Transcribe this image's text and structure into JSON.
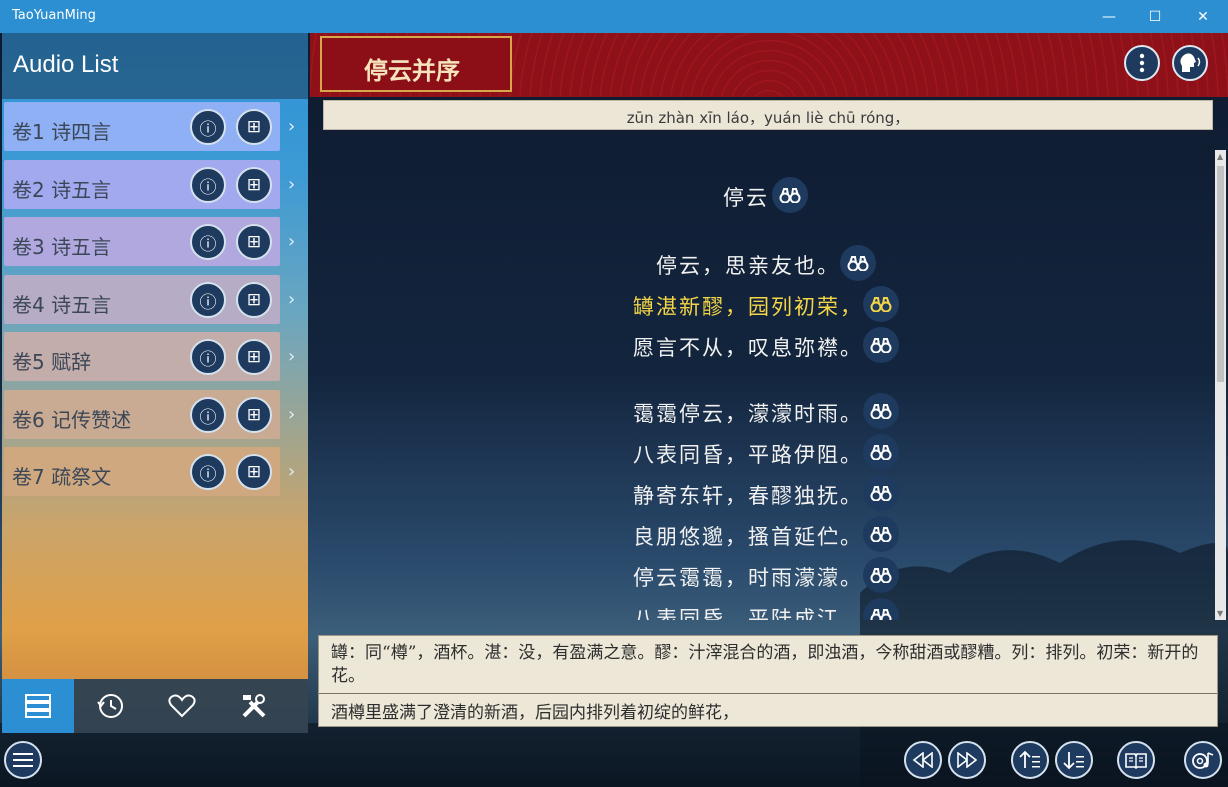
{
  "window": {
    "title": "TaoYuanMing",
    "minimize": "—",
    "maximize": "☐",
    "close": "✕"
  },
  "sidebar": {
    "title": "Audio List",
    "items": [
      {
        "label": "卷1 诗四言",
        "color": "#8fb0f4"
      },
      {
        "label": "卷2 诗五言",
        "color": "#a3a9ee"
      },
      {
        "label": "卷3 诗五言",
        "color": "#b0a8df"
      },
      {
        "label": "卷4 诗五言",
        "color": "#b7acc5"
      },
      {
        "label": "卷5 赋辞",
        "color": "#c3adab"
      },
      {
        "label": "卷6 记传赞述",
        "color": "#c9aa93"
      },
      {
        "label": "卷7 疏祭文",
        "color": "#cfa880"
      }
    ],
    "nav": [
      "list-icon",
      "history-icon",
      "heart-icon",
      "tools-icon"
    ]
  },
  "header": {
    "title": "停云并序"
  },
  "pinyin": "zūn zhàn xīn láo，yuán liè chū róng，",
  "poem": {
    "title": "停云",
    "lines": [
      "停云，思亲友也。",
      "罇湛新醪，园列初荣，",
      "愿言不从，叹息弥襟。",
      "霭霭停云，濛濛时雨。",
      "八表同昏，平路伊阻。",
      "静寄东轩，春醪独抚。",
      "良朋悠邈，搔首延伫。",
      "停云霭霭，时雨濛濛。",
      "八表同昏，平陆成江。"
    ],
    "highlight_color": "#f4d646"
  },
  "notes": {
    "annotation": "罇：同“樽”，酒杯。湛：没，有盈满之意。醪：汁滓混合的酒，即浊酒，今称甜酒或醪糟。列：排列。初荣：新开的花。",
    "translation": "酒樽里盛满了澄清的新酒，后园内排列着初绽的鲜花，"
  },
  "controls": [
    "menu-icon",
    "rewind-icon",
    "fast-forward-icon",
    "font-up-icon",
    "font-down-icon",
    "book-icon",
    "audio-settings-icon"
  ]
}
